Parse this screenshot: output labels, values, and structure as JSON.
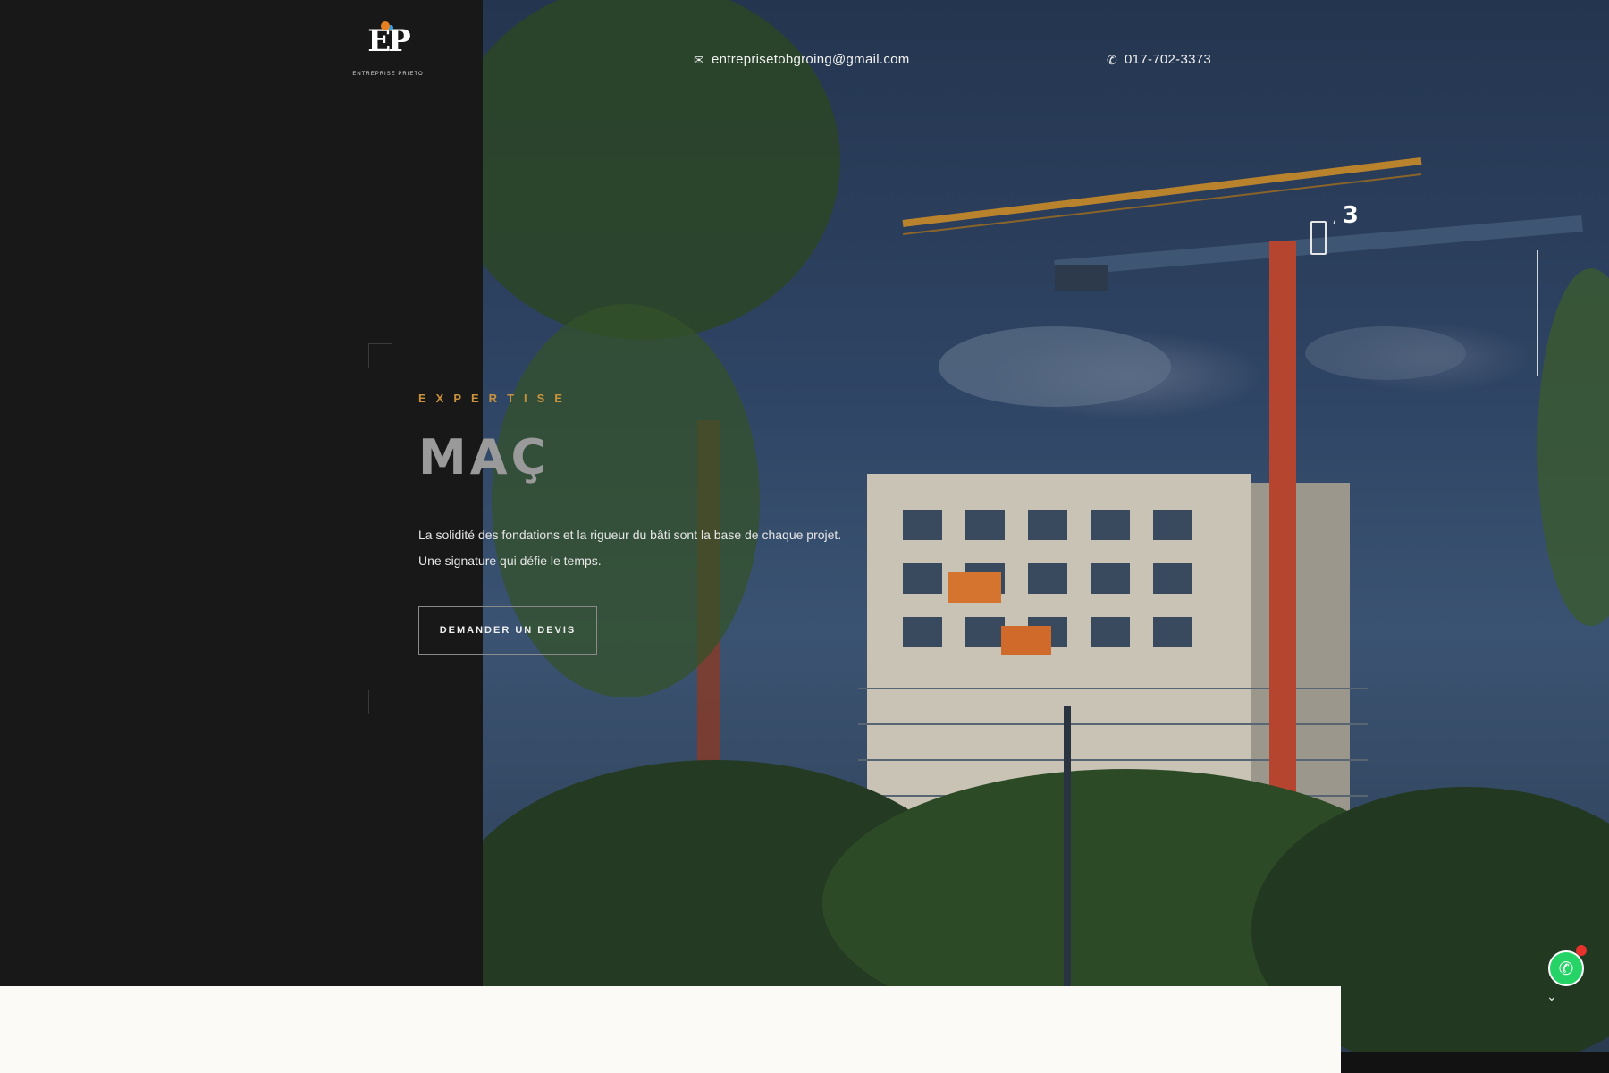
{
  "brand": {
    "logo_mark": "EP",
    "logo_tagline": "ENTREPRISE PRIETO"
  },
  "contact": {
    "email": "entreprisetobgroing@gmail.com",
    "phone": "017-702-3373"
  },
  "slider": {
    "current": "1",
    "separator": ",",
    "total": "3"
  },
  "hero": {
    "eyebrow": "EXPERTISE",
    "title": "MAÇ",
    "description_line1": "La solidité des fondations et la rigueur du bâti sont la base de chaque projet.",
    "description_line2": "Une signature qui défie le temps.",
    "cta_label": "DEMANDER UN DEVIS"
  },
  "icons": {
    "email": "envelope-icon",
    "phone": "phone-icon",
    "whatsapp": "whatsapp-icon",
    "scroll": "chevron-down-icon"
  },
  "colors": {
    "panel": "#181818",
    "accent_gold": "#c8913a",
    "whatsapp": "#25d366",
    "badge": "#e8322d"
  }
}
